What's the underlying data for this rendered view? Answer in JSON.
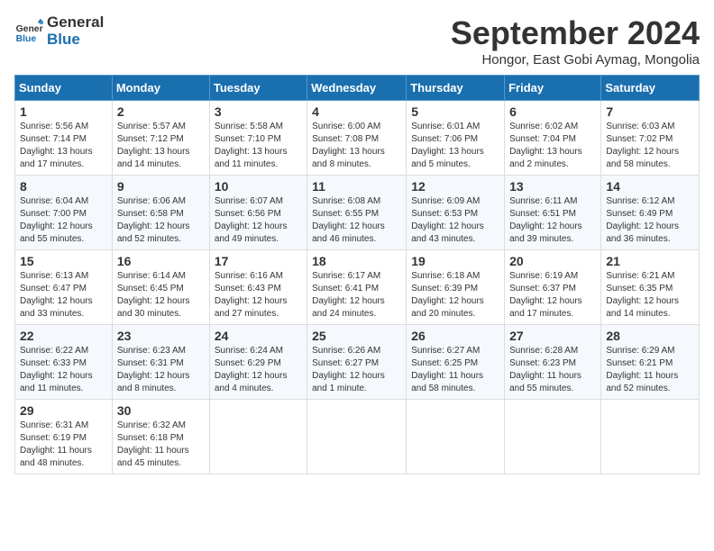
{
  "header": {
    "logo_line1": "General",
    "logo_line2": "Blue",
    "month_year": "September 2024",
    "location": "Hongor, East Gobi Aymag, Mongolia"
  },
  "weekdays": [
    "Sunday",
    "Monday",
    "Tuesday",
    "Wednesday",
    "Thursday",
    "Friday",
    "Saturday"
  ],
  "weeks": [
    [
      {
        "day": "1",
        "info": "Sunrise: 5:56 AM\nSunset: 7:14 PM\nDaylight: 13 hours and 17 minutes."
      },
      {
        "day": "2",
        "info": "Sunrise: 5:57 AM\nSunset: 7:12 PM\nDaylight: 13 hours and 14 minutes."
      },
      {
        "day": "3",
        "info": "Sunrise: 5:58 AM\nSunset: 7:10 PM\nDaylight: 13 hours and 11 minutes."
      },
      {
        "day": "4",
        "info": "Sunrise: 6:00 AM\nSunset: 7:08 PM\nDaylight: 13 hours and 8 minutes."
      },
      {
        "day": "5",
        "info": "Sunrise: 6:01 AM\nSunset: 7:06 PM\nDaylight: 13 hours and 5 minutes."
      },
      {
        "day": "6",
        "info": "Sunrise: 6:02 AM\nSunset: 7:04 PM\nDaylight: 13 hours and 2 minutes."
      },
      {
        "day": "7",
        "info": "Sunrise: 6:03 AM\nSunset: 7:02 PM\nDaylight: 12 hours and 58 minutes."
      }
    ],
    [
      {
        "day": "8",
        "info": "Sunrise: 6:04 AM\nSunset: 7:00 PM\nDaylight: 12 hours and 55 minutes."
      },
      {
        "day": "9",
        "info": "Sunrise: 6:06 AM\nSunset: 6:58 PM\nDaylight: 12 hours and 52 minutes."
      },
      {
        "day": "10",
        "info": "Sunrise: 6:07 AM\nSunset: 6:56 PM\nDaylight: 12 hours and 49 minutes."
      },
      {
        "day": "11",
        "info": "Sunrise: 6:08 AM\nSunset: 6:55 PM\nDaylight: 12 hours and 46 minutes."
      },
      {
        "day": "12",
        "info": "Sunrise: 6:09 AM\nSunset: 6:53 PM\nDaylight: 12 hours and 43 minutes."
      },
      {
        "day": "13",
        "info": "Sunrise: 6:11 AM\nSunset: 6:51 PM\nDaylight: 12 hours and 39 minutes."
      },
      {
        "day": "14",
        "info": "Sunrise: 6:12 AM\nSunset: 6:49 PM\nDaylight: 12 hours and 36 minutes."
      }
    ],
    [
      {
        "day": "15",
        "info": "Sunrise: 6:13 AM\nSunset: 6:47 PM\nDaylight: 12 hours and 33 minutes."
      },
      {
        "day": "16",
        "info": "Sunrise: 6:14 AM\nSunset: 6:45 PM\nDaylight: 12 hours and 30 minutes."
      },
      {
        "day": "17",
        "info": "Sunrise: 6:16 AM\nSunset: 6:43 PM\nDaylight: 12 hours and 27 minutes."
      },
      {
        "day": "18",
        "info": "Sunrise: 6:17 AM\nSunset: 6:41 PM\nDaylight: 12 hours and 24 minutes."
      },
      {
        "day": "19",
        "info": "Sunrise: 6:18 AM\nSunset: 6:39 PM\nDaylight: 12 hours and 20 minutes."
      },
      {
        "day": "20",
        "info": "Sunrise: 6:19 AM\nSunset: 6:37 PM\nDaylight: 12 hours and 17 minutes."
      },
      {
        "day": "21",
        "info": "Sunrise: 6:21 AM\nSunset: 6:35 PM\nDaylight: 12 hours and 14 minutes."
      }
    ],
    [
      {
        "day": "22",
        "info": "Sunrise: 6:22 AM\nSunset: 6:33 PM\nDaylight: 12 hours and 11 minutes."
      },
      {
        "day": "23",
        "info": "Sunrise: 6:23 AM\nSunset: 6:31 PM\nDaylight: 12 hours and 8 minutes."
      },
      {
        "day": "24",
        "info": "Sunrise: 6:24 AM\nSunset: 6:29 PM\nDaylight: 12 hours and 4 minutes."
      },
      {
        "day": "25",
        "info": "Sunrise: 6:26 AM\nSunset: 6:27 PM\nDaylight: 12 hours and 1 minute."
      },
      {
        "day": "26",
        "info": "Sunrise: 6:27 AM\nSunset: 6:25 PM\nDaylight: 11 hours and 58 minutes."
      },
      {
        "day": "27",
        "info": "Sunrise: 6:28 AM\nSunset: 6:23 PM\nDaylight: 11 hours and 55 minutes."
      },
      {
        "day": "28",
        "info": "Sunrise: 6:29 AM\nSunset: 6:21 PM\nDaylight: 11 hours and 52 minutes."
      }
    ],
    [
      {
        "day": "29",
        "info": "Sunrise: 6:31 AM\nSunset: 6:19 PM\nDaylight: 11 hours and 48 minutes."
      },
      {
        "day": "30",
        "info": "Sunrise: 6:32 AM\nSunset: 6:18 PM\nDaylight: 11 hours and 45 minutes."
      },
      null,
      null,
      null,
      null,
      null
    ]
  ]
}
